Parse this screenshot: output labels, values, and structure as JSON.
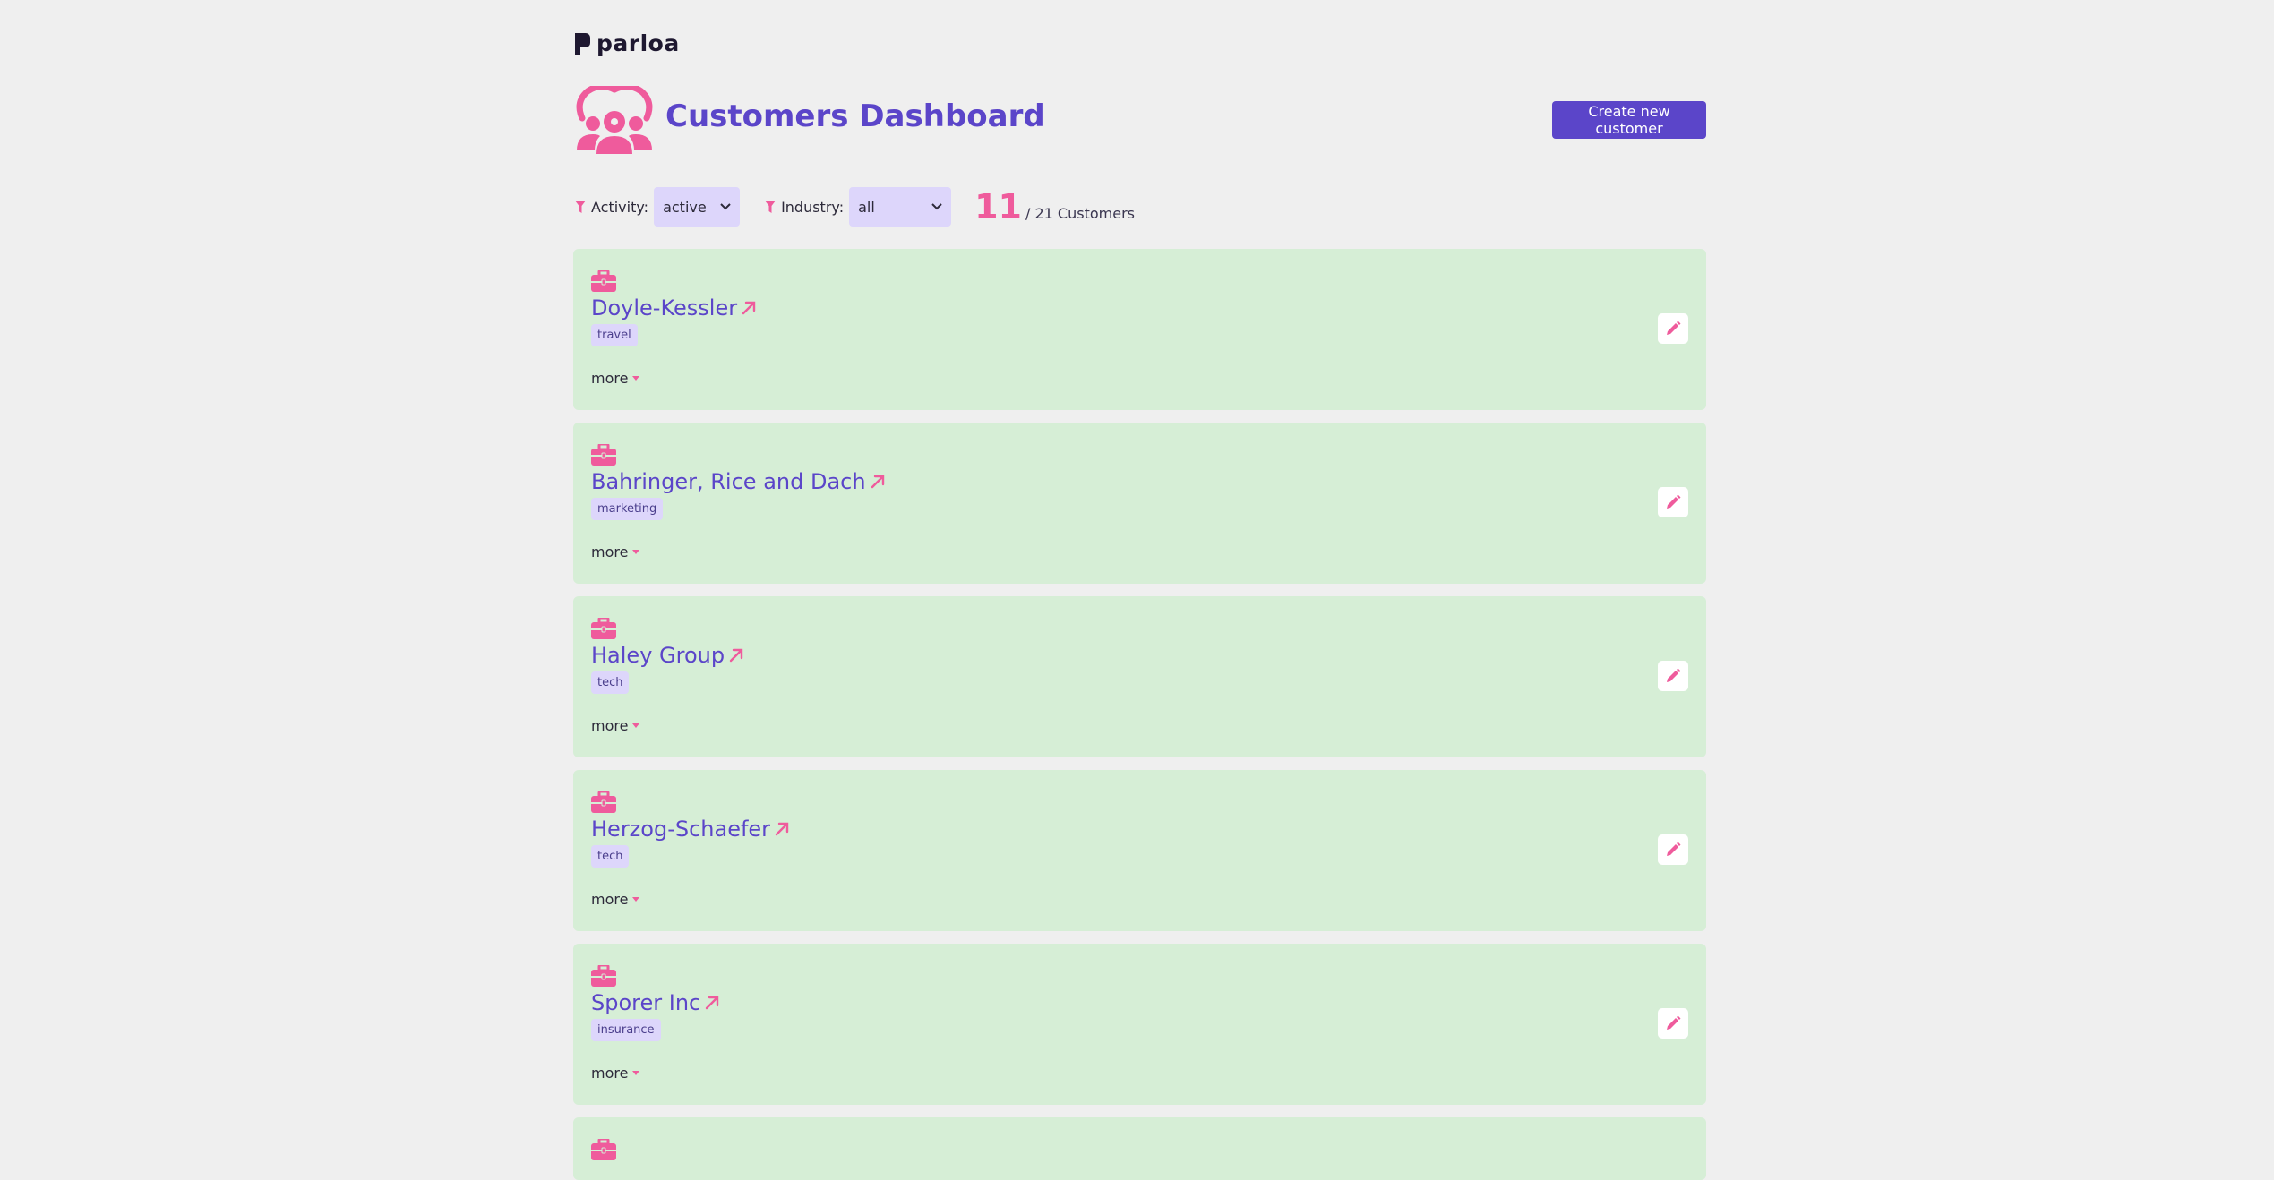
{
  "brand": {
    "name": "parloa"
  },
  "header": {
    "title": "Customers Dashboard",
    "create_button": "Create new customer"
  },
  "filters": {
    "activity_label": "Activity:",
    "activity_value": "active",
    "industry_label": "Industry:",
    "industry_value": "all"
  },
  "count": {
    "shown": "11",
    "total_text": "/ 21 Customers"
  },
  "colors": {
    "accent": "#5b45c9",
    "pink": "#ef5b9c",
    "card_bg": "#d6eed6",
    "tag_bg": "#ddd6fb",
    "page_bg": "#efefef"
  },
  "customers": [
    {
      "name": "Doyle-Kessler",
      "industry": "travel",
      "more": "more"
    },
    {
      "name": "Bahringer, Rice and Dach",
      "industry": "marketing",
      "more": "more"
    },
    {
      "name": "Haley Group",
      "industry": "tech",
      "more": "more"
    },
    {
      "name": "Herzog-Schaefer",
      "industry": "tech",
      "more": "more"
    },
    {
      "name": "Sporer Inc",
      "industry": "insurance",
      "more": "more"
    }
  ],
  "icons": {
    "logo": "parloa-logo-icon",
    "header": "customers-group-icon",
    "filter": "filter-icon",
    "card": "briefcase-icon",
    "link": "external-link-arrow-icon",
    "more": "chevron-down-icon",
    "edit": "pencil-icon"
  }
}
